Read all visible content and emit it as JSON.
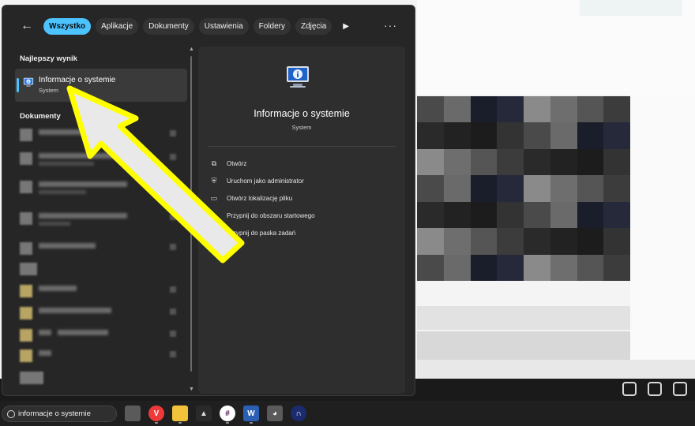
{
  "tabs": {
    "back_label": "←",
    "items": [
      "Wszystko",
      "Aplikacje",
      "Dokumenty",
      "Ustawienia",
      "Foldery",
      "Zdjęcia"
    ],
    "more_label": "▶",
    "options_label": "···"
  },
  "best_match": {
    "section_title": "Najlepszy wynik",
    "title": "Informacje o systemie",
    "subtitle": "System"
  },
  "documents": {
    "section_title": "Dokumenty"
  },
  "details": {
    "title": "Informacje o systemie",
    "subtitle": "System",
    "actions": [
      {
        "label": "Otwórz",
        "icon": "open-external-icon"
      },
      {
        "label": "Uruchom jako administrator",
        "icon": "shield-admin-icon"
      },
      {
        "label": "Otwórz lokalizację pliku",
        "icon": "folder-icon"
      },
      {
        "label": "Przypnij do obszaru startowego",
        "icon": "pin-icon"
      },
      {
        "label": "Przypnij do paska zadań",
        "icon": "pin-taskbar-icon"
      }
    ]
  },
  "taskbar": {
    "search_value": "informacje o systemie",
    "apps": [
      "file-explorer-icon",
      "vivaldi-icon",
      "folder-icon",
      "inkscape-icon",
      "slack-icon",
      "word-icon",
      "gimp-icon",
      "app-icon"
    ]
  },
  "colors": {
    "accent": "#4cc2ff",
    "arrow": "#ffff00",
    "flyout_bg": "#262626"
  }
}
